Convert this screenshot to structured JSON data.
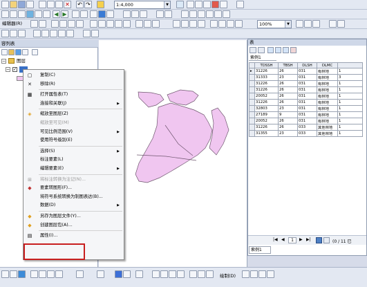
{
  "toolbar": {
    "scale_value": "1:4,000",
    "editor_label": "编辑器(R)",
    "zoom_value": "100%"
  },
  "toc": {
    "title": "容列表",
    "layer_group": "图层"
  },
  "context_menu": {
    "items": [
      {
        "label": "复制(C)",
        "icon": "copy-icon",
        "disabled": false,
        "submenu": false
      },
      {
        "label": "移除(R)",
        "icon": "remove-icon",
        "disabled": false,
        "submenu": false
      },
      {
        "label": "打开属性表(T)",
        "icon": "table-icon",
        "disabled": false,
        "submenu": false
      },
      {
        "label": "连接和关联(J)",
        "icon": "",
        "disabled": false,
        "submenu": true
      },
      {
        "label": "缩放至图层(Z)",
        "icon": "zoom-layer-icon",
        "disabled": false,
        "submenu": false
      },
      {
        "label": "缩放至可见(M)",
        "icon": "",
        "disabled": true,
        "submenu": false
      },
      {
        "label": "可见比例范围(V)",
        "icon": "",
        "disabled": false,
        "submenu": true
      },
      {
        "label": "使用符号级别(E)",
        "icon": "",
        "disabled": false,
        "submenu": false
      },
      {
        "label": "选择(S)",
        "icon": "",
        "disabled": false,
        "submenu": true
      },
      {
        "label": "标注要素(L)",
        "icon": "",
        "disabled": false,
        "submenu": false
      },
      {
        "label": "编辑要素(E)",
        "icon": "",
        "disabled": false,
        "submenu": true
      },
      {
        "label": "将标注转换为注记(N)...",
        "icon": "convert-label-icon",
        "disabled": true,
        "submenu": false
      },
      {
        "label": "要素转图形(F)...",
        "icon": "feature-graphic-icon",
        "disabled": false,
        "submenu": false
      },
      {
        "label": "将符号系统转换为制图表达(B)...",
        "icon": "",
        "disabled": false,
        "submenu": false
      },
      {
        "label": "数据(D)",
        "icon": "",
        "disabled": false,
        "submenu": true
      },
      {
        "label": "另存为图层文件(Y)...",
        "icon": "save-layer-icon",
        "disabled": false,
        "submenu": false
      },
      {
        "label": "创建图层包(A)...",
        "icon": "layer-package-icon",
        "disabled": false,
        "submenu": false
      },
      {
        "label": "属性(I)...",
        "icon": "properties-icon",
        "disabled": false,
        "submenu": false
      }
    ]
  },
  "table_window": {
    "title": "表",
    "tab_label": "索例1",
    "bottom_tab": "索例1",
    "columns": [
      "TDSSH",
      "TBSH",
      "DLSH",
      "DLMC",
      ""
    ],
    "rows": [
      [
        "31226",
        "26",
        "031",
        "有林地",
        "1"
      ],
      [
        "31333",
        "23",
        "031",
        "有林地",
        "3"
      ],
      [
        "31226",
        "26",
        "031",
        "有林地",
        "1"
      ],
      [
        "31226",
        "26",
        "031",
        "有林地",
        "1"
      ],
      [
        "20052",
        "26",
        "031",
        "有林地",
        "1"
      ],
      [
        "31226",
        "26",
        "031",
        "有林地",
        "1"
      ],
      [
        "32803",
        "23",
        "031",
        "有林地",
        "1"
      ],
      [
        "27189",
        "9",
        "031",
        "有林地",
        "1"
      ],
      [
        "20052",
        "26",
        "031",
        "有林地",
        "1"
      ],
      [
        "31226",
        "26",
        "033",
        "其他林地",
        "1"
      ],
      [
        "31355",
        "23",
        "033",
        "其他林地",
        "1"
      ]
    ],
    "nav_current": "1",
    "record_count": "(0 / 11 已"
  },
  "status_bar": {
    "draw_label": "绘制(D)"
  },
  "colors": {
    "polygon_fill": "#f0c6f0",
    "highlight_box": "#c81e1e"
  }
}
